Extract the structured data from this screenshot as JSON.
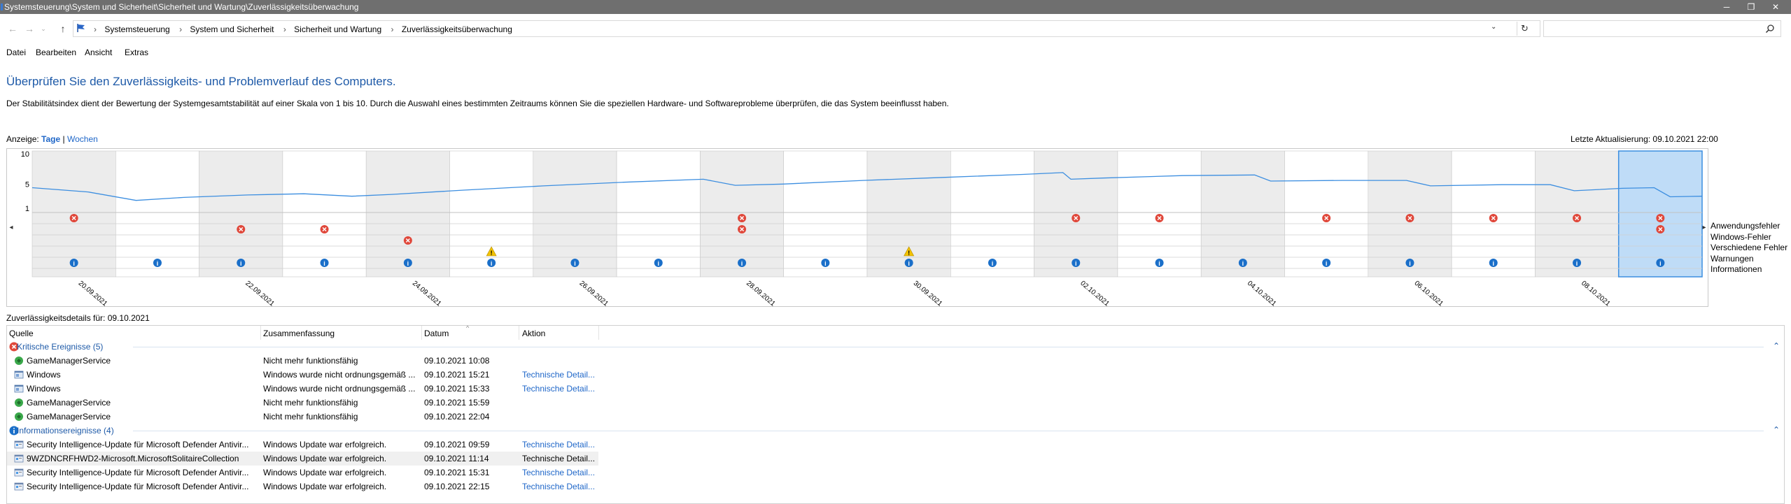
{
  "window": {
    "title": "Systemsteuerung\\System und Sicherheit\\Sicherheit und Wartung\\Zuverlässigkeitsüberwachung",
    "minimize": "─",
    "maximize": "❐",
    "close": "✕"
  },
  "address": {
    "crumbs": [
      "Systemsteuerung",
      "System und Sicherheit",
      "Sicherheit und Wartung",
      "Zuverlässigkeitsüberwachung"
    ],
    "search_value": ""
  },
  "menu": {
    "items": [
      "Datei",
      "Bearbeiten",
      "Ansicht",
      "Extras"
    ]
  },
  "page": {
    "heading": "Überprüfen Sie den Zuverlässigkeits- und Problemverlauf des Computers.",
    "description": "Der Stabilitätsindex dient der Bewertung der Systemgesamtstabilität auf einer Skala von 1 bis 10. Durch die Auswahl eines bestimmten Zeitraums können Sie die speziellen Hardware- und Softwareprobleme überprüfen, die das System beeinflusst haben.",
    "view_label": "Anzeige:",
    "view_days": "Tage",
    "view_sep": "|",
    "view_weeks": "Wochen",
    "last_update": "Letzte Aktualisierung: 09.10.2021 22:00"
  },
  "chart_data": {
    "type": "line",
    "y_ticks": [
      "10",
      "5",
      "1"
    ],
    "ylim": [
      1,
      10
    ],
    "x_labels": [
      "20.09.2021",
      "22.09.2021",
      "24.09.2021",
      "26.09.2021",
      "28.09.2021",
      "30.09.2021",
      "02.10.2021",
      "04.10.2021",
      "06.10.2021",
      "08.10.2021"
    ],
    "dates": [
      "20.09.2021",
      "21.09.2021",
      "22.09.2021",
      "23.09.2021",
      "24.09.2021",
      "25.09.2021",
      "26.09.2021",
      "27.09.2021",
      "28.09.2021",
      "29.09.2021",
      "30.09.2021",
      "01.10.2021",
      "02.10.2021",
      "03.10.2021",
      "04.10.2021",
      "05.10.2021",
      "06.10.2021",
      "07.10.2021",
      "08.10.2021",
      "09.10.2021"
    ],
    "selected_date": "09.10.2021",
    "stability_index_path": [
      [
        19.6,
        4.4
      ],
      [
        20.3,
        3.7
      ],
      [
        20.9,
        2.3
      ],
      [
        21.5,
        2.8
      ],
      [
        22.3,
        3.2
      ],
      [
        23.0,
        3.4
      ],
      [
        23.6,
        3.0
      ],
      [
        24.1,
        3.3
      ],
      [
        25.0,
        4.0
      ],
      [
        26.0,
        4.7
      ],
      [
        27.0,
        5.3
      ],
      [
        28.0,
        5.8
      ],
      [
        28.4,
        4.8
      ],
      [
        29.0,
        5.0
      ],
      [
        30.0,
        5.6
      ],
      [
        31.0,
        6.1
      ],
      [
        32.0,
        6.6
      ],
      [
        32.5,
        6.9
      ],
      [
        32.6,
        5.8
      ],
      [
        33.0,
        6.0
      ],
      [
        34.0,
        6.4
      ],
      [
        34.9,
        6.5
      ],
      [
        35.1,
        5.5
      ],
      [
        36.0,
        5.6
      ],
      [
        36.8,
        5.6
      ],
      [
        37.1,
        4.7
      ],
      [
        38.0,
        4.9
      ],
      [
        38.6,
        4.9
      ],
      [
        38.9,
        3.9
      ],
      [
        39.5,
        4.3
      ],
      [
        39.9,
        4.4
      ],
      [
        40.1,
        2.9
      ],
      [
        40.5,
        3.0
      ]
    ],
    "legend": [
      "Anwendungsfehler",
      "Windows-Fehler",
      "Verschiedene Fehler",
      "Warnungen",
      "Informationen"
    ],
    "events": {
      "Anwendungsfehler": [
        0,
        8,
        12,
        13,
        15,
        16,
        17,
        18,
        19
      ],
      "Windows-Fehler": [
        2,
        3,
        8,
        19
      ],
      "Verschiedene Fehler": [
        4
      ],
      "Warnungen": [
        5,
        10
      ],
      "Informationen": [
        0,
        1,
        2,
        3,
        4,
        5,
        6,
        7,
        8,
        9,
        10,
        11,
        12,
        13,
        14,
        15,
        16,
        17,
        18,
        19
      ]
    },
    "grid": true
  },
  "details": {
    "title": "Zuverlässigkeitsdetails für: 09.10.2021",
    "columns": [
      "Quelle",
      "Zusammenfassung",
      "Datum",
      "Aktion"
    ],
    "groups": [
      {
        "label": "Kritische Ereignisse (5)",
        "icon": "critical-icon",
        "rows": [
          {
            "icon": "gamemanager-icon",
            "source": "GameManagerService",
            "summary": "Nicht mehr funktionsfähig",
            "date": "09.10.2021 10:08",
            "action": ""
          },
          {
            "icon": "windows-icon",
            "source": "Windows",
            "summary": "Windows wurde nicht ordnungsgemäß ...",
            "date": "09.10.2021 15:21",
            "action": "Technische Detail..."
          },
          {
            "icon": "windows-icon",
            "source": "Windows",
            "summary": "Windows wurde nicht ordnungsgemäß ...",
            "date": "09.10.2021 15:33",
            "action": "Technische Detail..."
          },
          {
            "icon": "gamemanager-icon",
            "source": "GameManagerService",
            "summary": "Nicht mehr funktionsfähig",
            "date": "09.10.2021 15:59",
            "action": ""
          },
          {
            "icon": "gamemanager-icon",
            "source": "GameManagerService",
            "summary": "Nicht mehr funktionsfähig",
            "date": "09.10.2021 22:04",
            "action": ""
          }
        ]
      },
      {
        "label": "Informationsereignisse (4)",
        "icon": "info-icon",
        "rows": [
          {
            "icon": "update-icon",
            "source": "Security Intelligence-Update für Microsoft Defender Antivir...",
            "summary": "Windows Update war erfolgreich.",
            "date": "09.10.2021 09:59",
            "action": "Technische Detail..."
          },
          {
            "icon": "update-icon",
            "source": "9WZDNCRFHWD2-Microsoft.MicrosoftSolitaireCollection",
            "summary": "Windows Update war erfolgreich.",
            "date": "09.10.2021 11:14",
            "action": "Technische Detail..."
          },
          {
            "icon": "update-icon",
            "source": "Security Intelligence-Update für Microsoft Defender Antivir...",
            "summary": "Windows Update war erfolgreich.",
            "date": "09.10.2021 15:31",
            "action": "Technische Detail..."
          },
          {
            "icon": "update-icon",
            "source": "Security Intelligence-Update für Microsoft Defender Antivir...",
            "summary": "Windows Update war erfolgreich.",
            "date": "09.10.2021 22:15",
            "action": "Technische Detail..."
          }
        ]
      }
    ]
  },
  "colors": {
    "accent": "#1e66c8",
    "heading": "#1e5aa8",
    "chart_line": "#3c8ee0",
    "selected_column": "#bfdcf7",
    "shaded_column": "#ececec",
    "error": "#e0473a",
    "warning": "#f2c200",
    "info": "#1a6fc9"
  }
}
